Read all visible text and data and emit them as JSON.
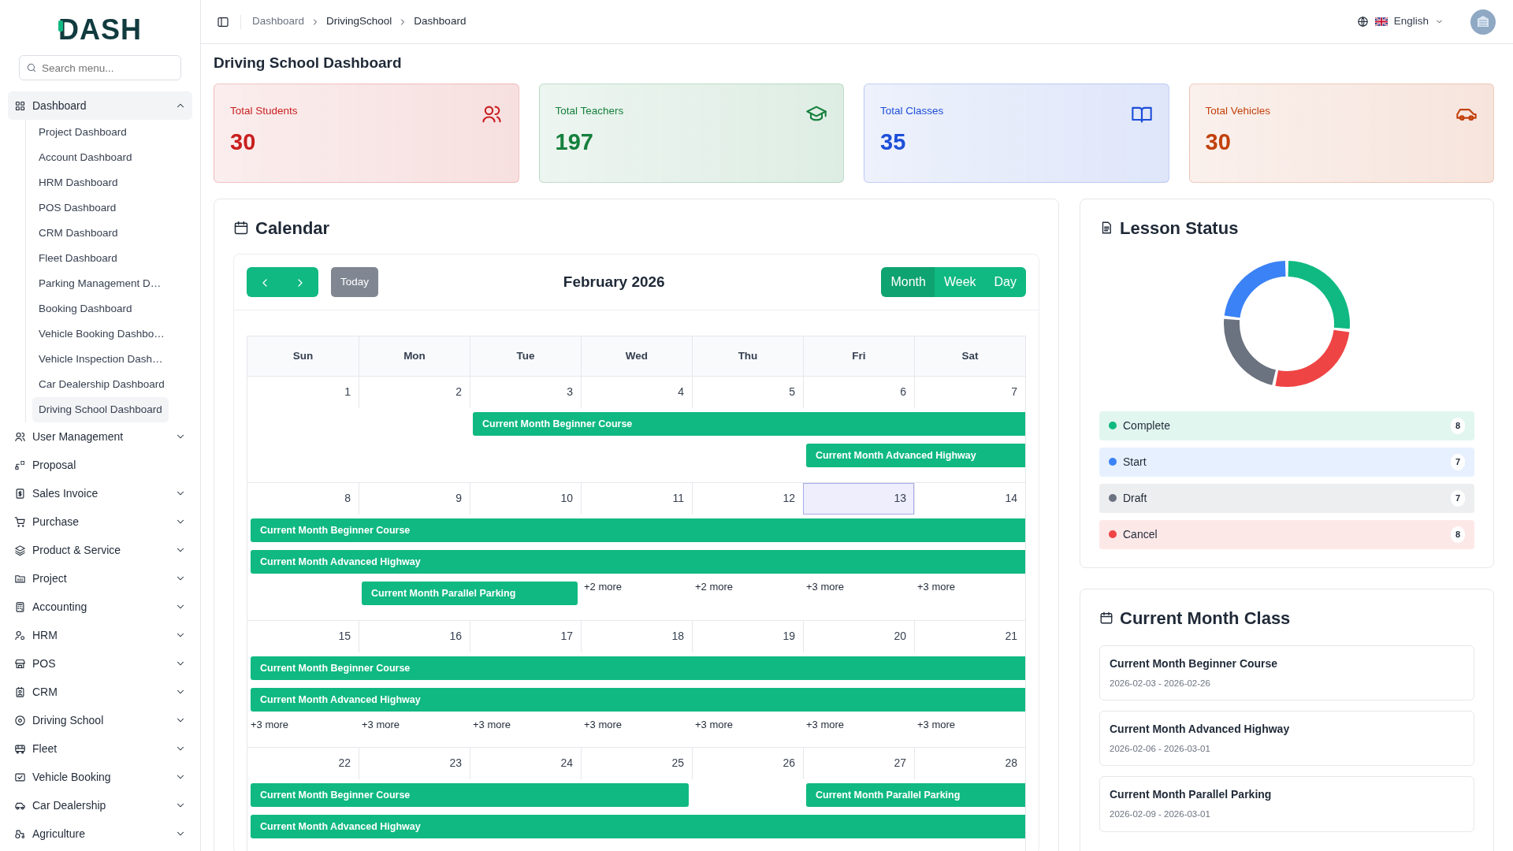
{
  "sidebar": {
    "logo": "DASH",
    "search": {
      "placeholder": "Search menu..."
    },
    "items": [
      {
        "label": "Dashboard",
        "has_submenu": true,
        "expanded": true,
        "selected": true,
        "children": [
          {
            "label": "Project Dashboard",
            "selected": false
          },
          {
            "label": "Account Dashboard",
            "selected": false
          },
          {
            "label": "HRM Dashboard",
            "selected": false
          },
          {
            "label": "POS Dashboard",
            "selected": false
          },
          {
            "label": "CRM Dashboard",
            "selected": false
          },
          {
            "label": "Fleet Dashboard",
            "selected": false
          },
          {
            "label": "Parking Management D…",
            "selected": false
          },
          {
            "label": "Booking Dashboard",
            "selected": false
          },
          {
            "label": "Vehicle Booking Dashbo…",
            "selected": false
          },
          {
            "label": "Vehicle Inspection Dash…",
            "selected": false
          },
          {
            "label": "Car Dealership Dashboard",
            "selected": false
          },
          {
            "label": "Driving School Dashboard",
            "selected": true
          }
        ]
      },
      {
        "label": "User Management",
        "has_submenu": true,
        "expanded": false,
        "selected": false
      },
      {
        "label": "Proposal",
        "has_submenu": false,
        "expanded": false,
        "selected": false
      },
      {
        "label": "Sales Invoice",
        "has_submenu": true,
        "expanded": false,
        "selected": false
      },
      {
        "label": "Purchase",
        "has_submenu": true,
        "expanded": false,
        "selected": false
      },
      {
        "label": "Product & Service",
        "has_submenu": true,
        "expanded": false,
        "selected": false
      },
      {
        "label": "Project",
        "has_submenu": true,
        "expanded": false,
        "selected": false
      },
      {
        "label": "Accounting",
        "has_submenu": true,
        "expanded": false,
        "selected": false
      },
      {
        "label": "HRM",
        "has_submenu": true,
        "expanded": false,
        "selected": false
      },
      {
        "label": "POS",
        "has_submenu": true,
        "expanded": false,
        "selected": false
      },
      {
        "label": "CRM",
        "has_submenu": true,
        "expanded": false,
        "selected": false
      },
      {
        "label": "Driving School",
        "has_submenu": true,
        "expanded": false,
        "selected": false
      },
      {
        "label": "Fleet",
        "has_submenu": true,
        "expanded": false,
        "selected": false
      },
      {
        "label": "Vehicle Booking",
        "has_submenu": true,
        "expanded": false,
        "selected": false
      },
      {
        "label": "Car Dealership",
        "has_submenu": true,
        "expanded": false,
        "selected": false
      },
      {
        "label": "Agriculture",
        "has_submenu": true,
        "expanded": false,
        "selected": false
      }
    ]
  },
  "header": {
    "breadcrumb": [
      {
        "label": "Dashboard",
        "muted": true
      },
      {
        "label": "DrivingSchool",
        "muted": false
      },
      {
        "label": "Dashboard",
        "muted": false
      }
    ],
    "language": "English"
  },
  "page_title": "Driving School Dashboard",
  "stats": [
    {
      "title": "Total Students",
      "value": "30",
      "color": "#c81e1e"
    },
    {
      "title": "Total Teachers",
      "value": "197",
      "color": "#15803d"
    },
    {
      "title": "Total Classes",
      "value": "35",
      "color": "#1d4ed8"
    },
    {
      "title": "Total Vehicles",
      "value": "30",
      "color": "#c2410c"
    }
  ],
  "calendar": {
    "title": "Calendar",
    "month": "February 2026",
    "today_button": {
      "label": "Today",
      "disabled": true
    },
    "views": [
      {
        "label": "Month",
        "selected": true
      },
      {
        "label": "Week",
        "selected": false
      },
      {
        "label": "Day",
        "selected": false
      }
    ],
    "weekdays": [
      "Sun",
      "Mon",
      "Tue",
      "Wed",
      "Thu",
      "Fri",
      "Sat"
    ],
    "weeks": [
      {
        "days": [
          {
            "date": "1",
            "today": false
          },
          {
            "date": "2",
            "today": false
          },
          {
            "date": "3",
            "today": false
          },
          {
            "date": "4",
            "today": false
          },
          {
            "date": "5",
            "today": false
          },
          {
            "date": "6",
            "today": false
          },
          {
            "date": "7",
            "today": false
          }
        ],
        "lanes": [
          [
            {
              "kind": "none"
            },
            {
              "kind": "none"
            },
            {
              "kind": "start",
              "title": "Current Month Beginner Course"
            },
            {
              "kind": "cont"
            },
            {
              "kind": "cont"
            },
            {
              "kind": "cont"
            },
            {
              "kind": "cont"
            }
          ],
          [
            {
              "kind": "none"
            },
            {
              "kind": "none"
            },
            {
              "kind": "none"
            },
            {
              "kind": "none"
            },
            {
              "kind": "none"
            },
            {
              "kind": "start",
              "title": "Current Month Advanced Highway"
            },
            {
              "kind": "cont"
            }
          ]
        ]
      },
      {
        "days": [
          {
            "date": "8",
            "today": false
          },
          {
            "date": "9",
            "today": false
          },
          {
            "date": "10",
            "today": false
          },
          {
            "date": "11",
            "today": false,
            "more": "+2 more"
          },
          {
            "date": "12",
            "today": false,
            "more": "+2 more"
          },
          {
            "date": "13",
            "today": true,
            "more": "+3 more"
          },
          {
            "date": "14",
            "today": false,
            "more": "+3 more"
          }
        ],
        "lanes": [
          [
            {
              "kind": "start",
              "title": "Current Month Beginner Course"
            },
            {
              "kind": "cont"
            },
            {
              "kind": "cont"
            },
            {
              "kind": "cont"
            },
            {
              "kind": "cont"
            },
            {
              "kind": "cont"
            },
            {
              "kind": "cont"
            }
          ],
          [
            {
              "kind": "start",
              "title": "Current Month Advanced Highway"
            },
            {
              "kind": "cont"
            },
            {
              "kind": "cont"
            },
            {
              "kind": "cont"
            },
            {
              "kind": "cont"
            },
            {
              "kind": "cont"
            },
            {
              "kind": "cont"
            }
          ],
          [
            {
              "kind": "none"
            },
            {
              "kind": "start",
              "title": "Current Month Parallel Parking"
            },
            {
              "kind": "cont"
            },
            {
              "kind": "none"
            },
            {
              "kind": "none"
            },
            {
              "kind": "none"
            },
            {
              "kind": "none"
            }
          ]
        ]
      },
      {
        "days": [
          {
            "date": "15",
            "today": false,
            "more": "+3 more"
          },
          {
            "date": "16",
            "today": false,
            "more": "+3 more"
          },
          {
            "date": "17",
            "today": false,
            "more": "+3 more"
          },
          {
            "date": "18",
            "today": false,
            "more": "+3 more"
          },
          {
            "date": "19",
            "today": false,
            "more": "+3 more"
          },
          {
            "date": "20",
            "today": false,
            "more": "+3 more"
          },
          {
            "date": "21",
            "today": false,
            "more": "+3 more"
          }
        ],
        "lanes": [
          [
            {
              "kind": "start",
              "title": "Current Month Beginner Course"
            },
            {
              "kind": "cont"
            },
            {
              "kind": "cont"
            },
            {
              "kind": "cont"
            },
            {
              "kind": "cont"
            },
            {
              "kind": "cont"
            },
            {
              "kind": "cont"
            }
          ],
          [
            {
              "kind": "start",
              "title": "Current Month Advanced Highway"
            },
            {
              "kind": "cont"
            },
            {
              "kind": "cont"
            },
            {
              "kind": "cont"
            },
            {
              "kind": "cont"
            },
            {
              "kind": "cont"
            },
            {
              "kind": "cont"
            }
          ]
        ]
      },
      {
        "days": [
          {
            "date": "22",
            "today": false
          },
          {
            "date": "23",
            "today": false
          },
          {
            "date": "24",
            "today": false
          },
          {
            "date": "25",
            "today": false
          },
          {
            "date": "26",
            "today": false
          },
          {
            "date": "27",
            "today": false
          },
          {
            "date": "28",
            "today": false
          }
        ],
        "lanes": [
          [
            {
              "kind": "start",
              "title": "Current Month Beginner Course"
            },
            {
              "kind": "cont"
            },
            {
              "kind": "cont"
            },
            {
              "kind": "cont"
            },
            {
              "kind": "none"
            },
            {
              "kind": "start",
              "title": "Current Month Parallel Parking"
            },
            {
              "kind": "cont"
            }
          ],
          [
            {
              "kind": "start",
              "title": "Current Month Advanced Highway"
            },
            {
              "kind": "cont"
            },
            {
              "kind": "cont"
            },
            {
              "kind": "cont"
            },
            {
              "kind": "cont"
            },
            {
              "kind": "cont"
            },
            {
              "kind": "cont"
            }
          ]
        ]
      }
    ]
  },
  "lesson_status": {
    "title": "Lesson Status",
    "chart_data": {
      "type": "donut",
      "categories": [
        "Complete",
        "Start",
        "Draft",
        "Cancel"
      ],
      "series": [
        {
          "values": [
            26.67,
            23.33,
            23.33,
            26.67
          ]
        }
      ],
      "colors": [
        "#10b981",
        "#3b82f6",
        "#6b7280",
        "#ef4444"
      ]
    },
    "legend": [
      {
        "count": "8"
      },
      {
        "count": "7"
      },
      {
        "count": "7"
      },
      {
        "count": "8"
      }
    ]
  },
  "current_month_class": {
    "title": "Current Month Class",
    "items": [
      {
        "name": "Current Month Beginner Course",
        "dates": "2026-02-03 - 2026-02-26"
      },
      {
        "name": "Current Month Advanced Highway",
        "dates": "2026-02-06 - 2026-03-01"
      },
      {
        "name": "Current Month Parallel Parking",
        "dates": "2026-02-09 - 2026-03-01"
      }
    ]
  }
}
